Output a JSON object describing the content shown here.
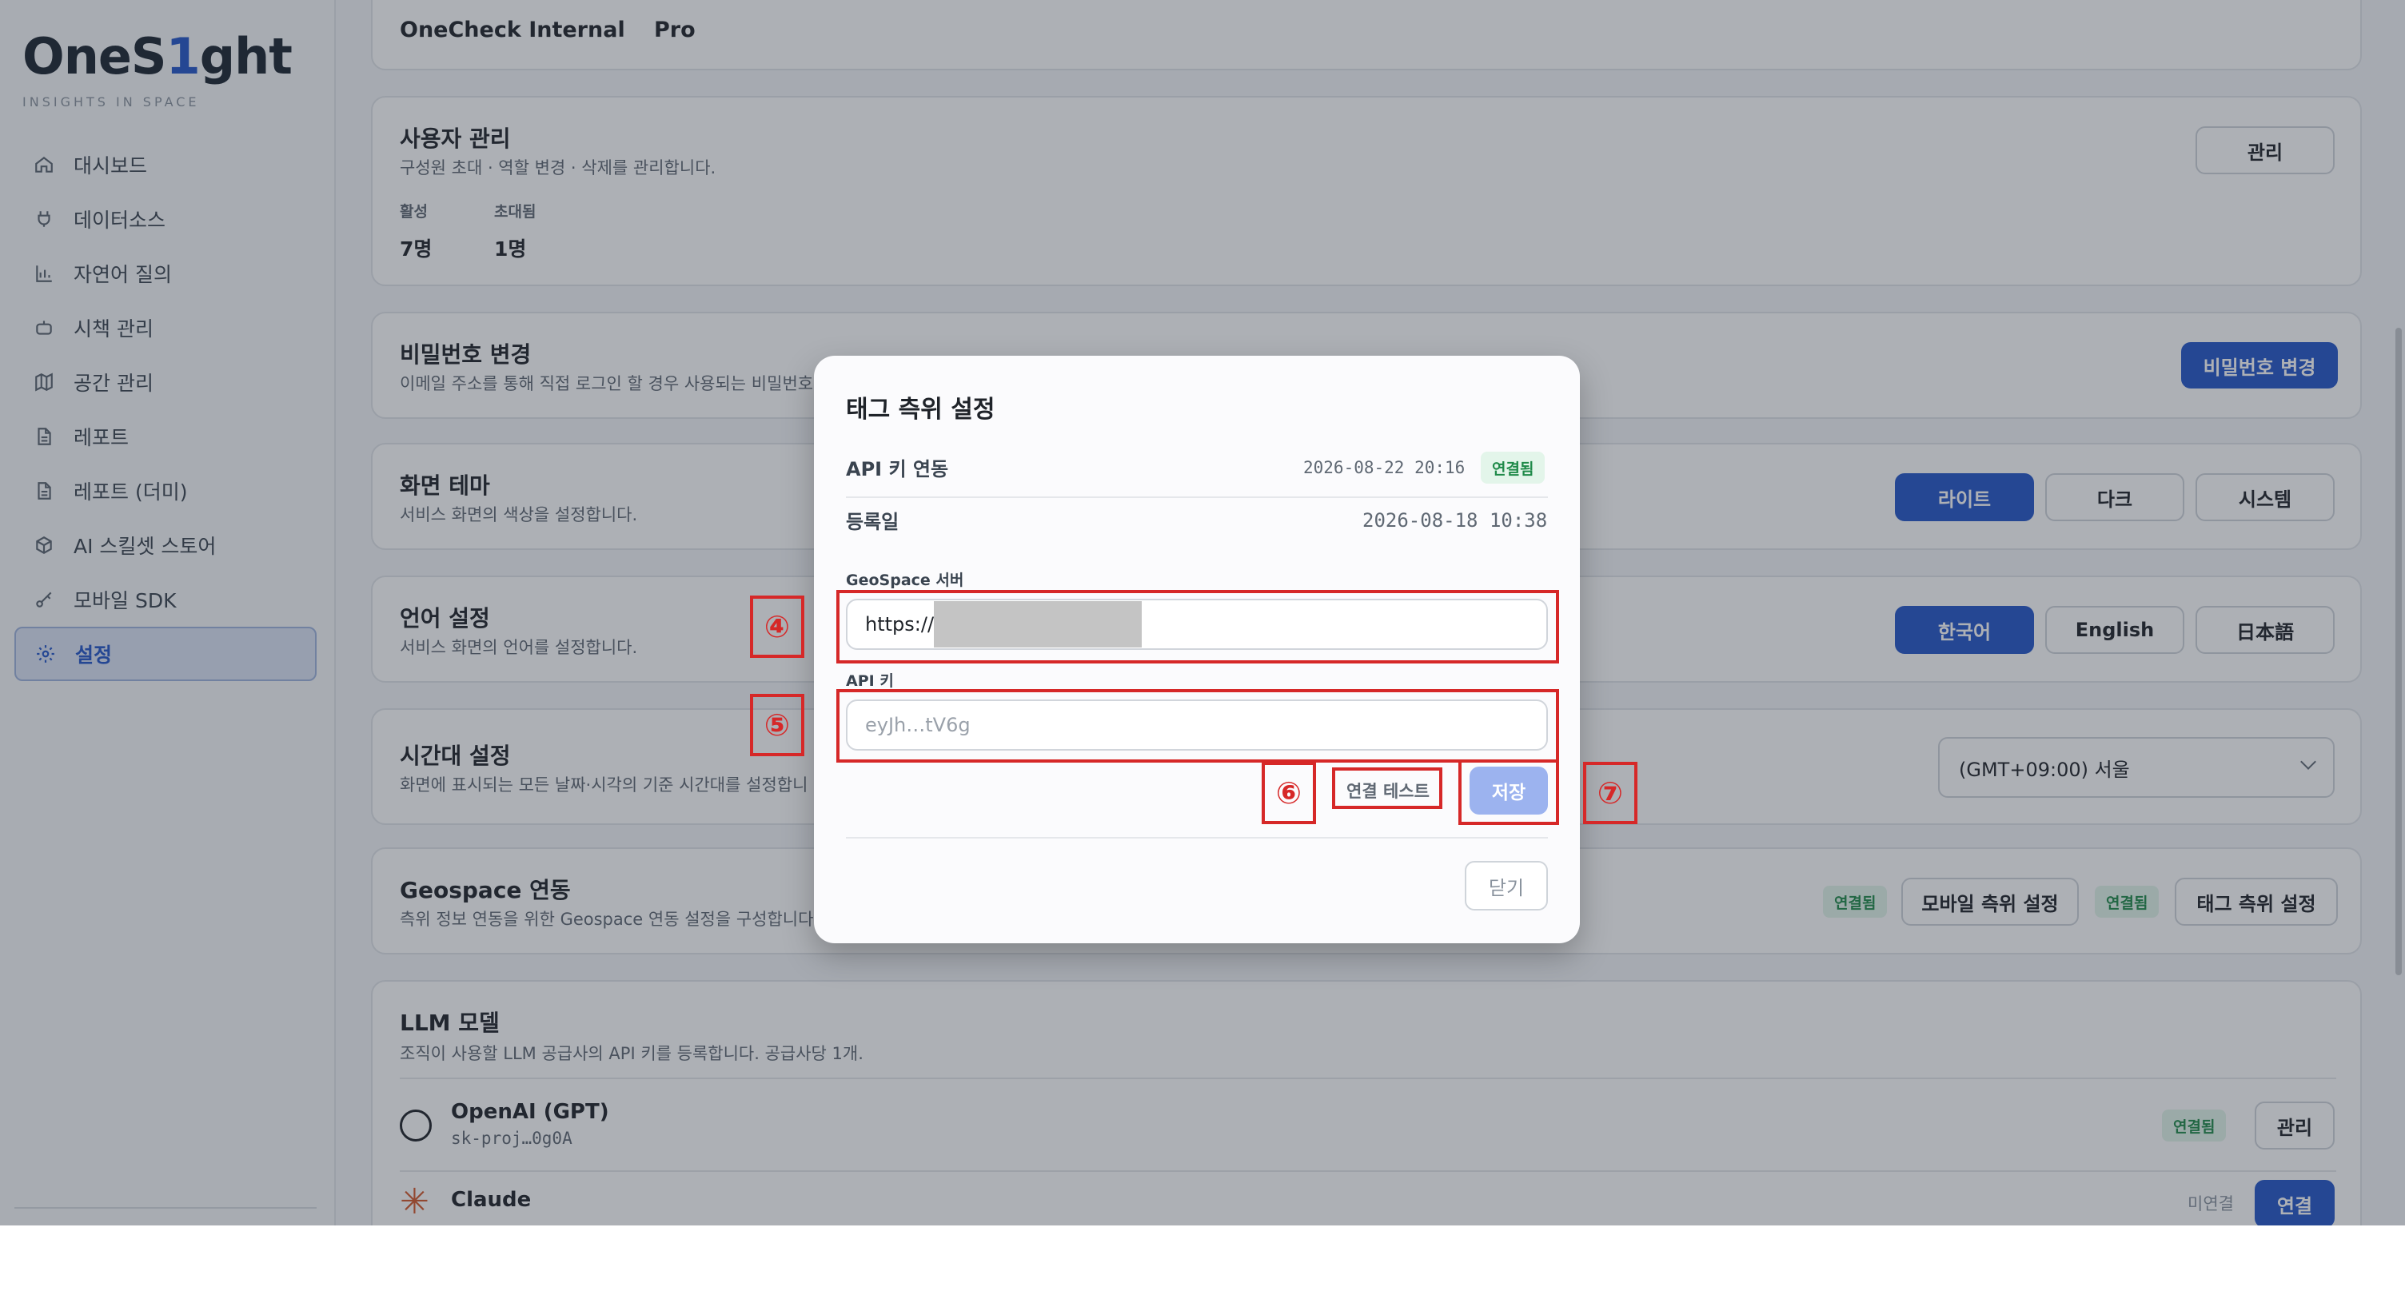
{
  "sidebar": {
    "logo_prefix": "OneS",
    "logo_accent": "1",
    "logo_suffix": "ght",
    "tagline": "INSIGHTS IN SPACE",
    "items": [
      {
        "label": "대시보드",
        "icon": "home-icon"
      },
      {
        "label": "데이터소스",
        "icon": "plug-icon"
      },
      {
        "label": "자연어 질의",
        "icon": "bar-chart-icon"
      },
      {
        "label": "시책 관리",
        "icon": "robot-icon"
      },
      {
        "label": "공간 관리",
        "icon": "map-icon"
      },
      {
        "label": "레포트",
        "icon": "document-icon"
      },
      {
        "label": "레포트 (더미)",
        "icon": "document-icon"
      },
      {
        "label": "AI 스킬셋 스토어",
        "icon": "cube-icon"
      },
      {
        "label": "모바일 SDK",
        "icon": "key-icon"
      },
      {
        "label": "설정",
        "icon": "gear-icon",
        "active": true
      }
    ]
  },
  "org_card": {
    "name": "OneCheck Internal",
    "plan": "Pro"
  },
  "users_card": {
    "title": "사용자 관리",
    "desc": "구성원 초대 · 역할 변경 · 삭제를 관리합니다.",
    "active_label": "활성",
    "active_value": "7명",
    "invited_label": "초대됨",
    "invited_value": "1명",
    "manage_button": "관리"
  },
  "password_card": {
    "title": "비밀번호 변경",
    "desc": "이메일 주소를 통해 직접 로그인 할 경우 사용되는 비밀번호",
    "button": "비밀번호 변경"
  },
  "theme_card": {
    "title": "화면 테마",
    "desc": "서비스 화면의 색상을 설정합니다.",
    "options": [
      "라이트",
      "다크",
      "시스템"
    ],
    "selected": "라이트"
  },
  "language_card": {
    "title": "언어 설정",
    "desc": "서비스 화면의 언어를 설정합니다.",
    "options": [
      "한국어",
      "English",
      "日本語"
    ],
    "selected": "한국어"
  },
  "timezone_card": {
    "title": "시간대 설정",
    "desc": "화면에 표시되는 모든 날짜·시각의 기준 시간대를 설정합니",
    "value": "(GMT+09:00) 서울"
  },
  "geospace_card": {
    "title": "Geospace 연동",
    "desc": "측위 정보 연동을 위한 Geospace 연동 설정을 구성합니다",
    "badge1": "연결됨",
    "mobile_button": "모바일 측위 설정",
    "badge2": "연결됨",
    "tag_button": "태그 측위 설정"
  },
  "llm_card": {
    "title": "LLM 모델",
    "desc": "조직이 사용할 LLM 공급사의 API 키를 등록합니다. 공급사당 1개.",
    "providers": [
      {
        "name": "OpenAI (GPT)",
        "key": "sk-proj…0g0A",
        "status": "연결됨",
        "action": "관리"
      },
      {
        "name": "Claude",
        "key": "",
        "status": "미연결",
        "action": "연결"
      }
    ]
  },
  "modal": {
    "title": "태그 측위 설정",
    "api_key_link_label": "API 키 연동",
    "api_key_link_date": "2026-08-22 20:16",
    "api_key_link_status": "연결됨",
    "registered_label": "등록일",
    "registered_date": "2026-08-18 10:38",
    "server_label": "GeoSpace 서버",
    "server_value": "https://",
    "api_key_label": "API 키",
    "api_key_placeholder": "eyJh…tV6g",
    "test_button": "연결 테스트",
    "save_button": "저장",
    "close_button": "닫기"
  },
  "markers": {
    "m4": "④",
    "m5": "⑤",
    "m6": "⑥",
    "m7": "⑦"
  },
  "colors": {
    "accent": "#2456c9",
    "annotation": "#d62828",
    "connected": "#1f8a49"
  }
}
